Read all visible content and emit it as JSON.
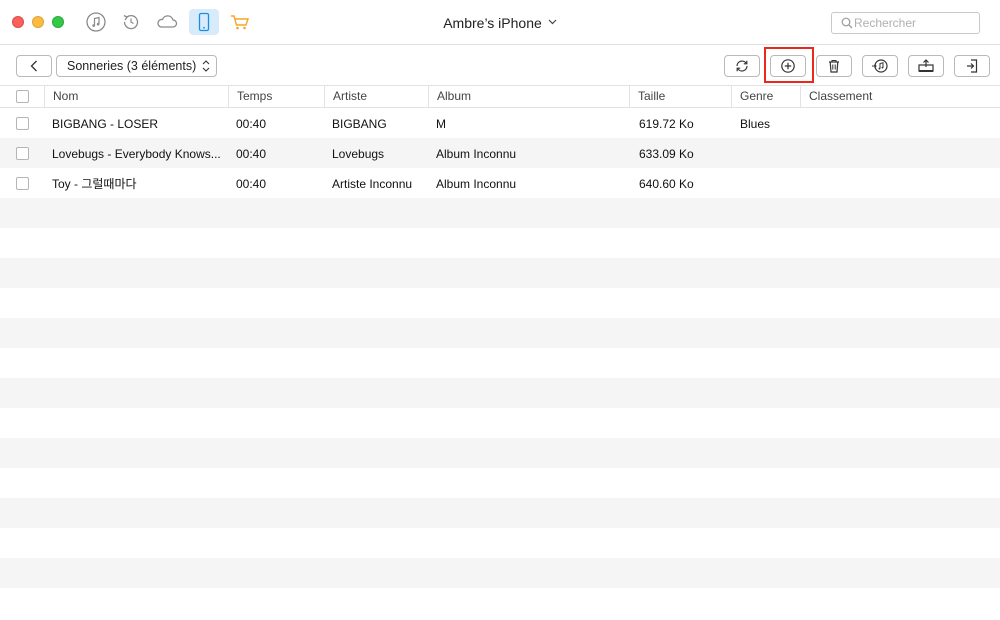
{
  "window": {
    "device_name": "Ambre’s iPhone",
    "search_placeholder": "Rechercher"
  },
  "nav_icons": [
    "music-note-icon",
    "restore-icon",
    "cloud-icon",
    "phone-icon",
    "cart-icon"
  ],
  "toolbar": {
    "category_select": "Sonneries (3 éléments)",
    "tool_buttons": [
      "refresh-icon",
      "add-icon",
      "trash-icon",
      "to-itunes-icon",
      "to-computer-icon",
      "to-device-icon"
    ]
  },
  "colors": {
    "accent": "#1a8ee6",
    "highlight": "#e8291c",
    "cart": "#f5a623"
  },
  "table": {
    "columns": [
      "Nom",
      "Temps",
      "Artiste",
      "Album",
      "Taille",
      "Genre",
      "Classement"
    ],
    "rows": [
      {
        "nom": "BIGBANG - LOSER",
        "temps": "00:40",
        "artiste": "BIGBANG",
        "album": "M",
        "taille": "619.72 Ko",
        "genre": "Blues",
        "classement": ""
      },
      {
        "nom": "Lovebugs - Everybody Knows...",
        "temps": "00:40",
        "artiste": "Lovebugs",
        "album": "Album Inconnu",
        "taille": "633.09 Ko",
        "genre": "",
        "classement": ""
      },
      {
        "nom": "Toy - 그럴때마다",
        "temps": "00:40",
        "artiste": "Artiste Inconnu",
        "album": "Album Inconnu",
        "taille": "640.60 Ko",
        "genre": "",
        "classement": ""
      }
    ]
  }
}
